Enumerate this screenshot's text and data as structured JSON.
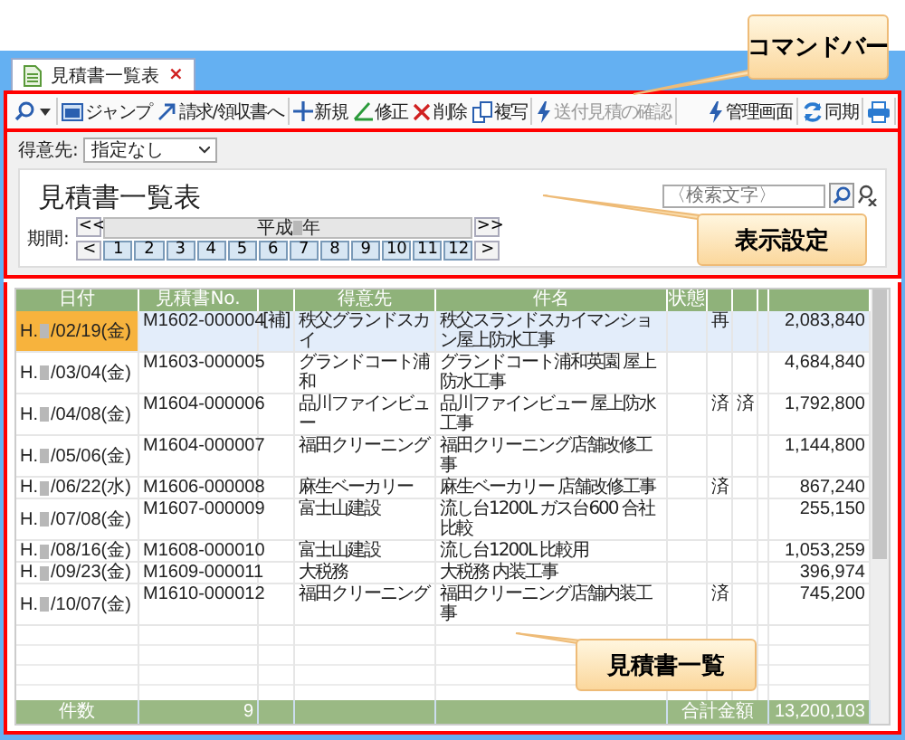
{
  "tab": {
    "title": "見積書一覧表",
    "close": "×"
  },
  "toolbar": {
    "groups": [
      [
        {
          "kind": "jump",
          "label": "ジャンプ",
          "disabled": false
        },
        {
          "kind": "arrow",
          "label": "請求/領収書へ",
          "disabled": false
        }
      ],
      [
        {
          "kind": "plus",
          "label": "新規",
          "disabled": false
        },
        {
          "kind": "pencil",
          "label": "修正",
          "disabled": false
        },
        {
          "kind": "cross",
          "label": "削除",
          "disabled": false
        },
        {
          "kind": "copy",
          "label": "複写",
          "disabled": false
        }
      ],
      [
        {
          "kind": "bolt",
          "label": "送付見積の確認",
          "disabled": true
        }
      ]
    ],
    "right_groups": [
      [
        {
          "kind": "bolt",
          "label": "管理画面",
          "disabled": false
        }
      ],
      [
        {
          "kind": "refresh",
          "label": "同期",
          "disabled": false
        }
      ],
      [
        {
          "kind": "printer"
        }
      ]
    ]
  },
  "customer_filter": {
    "label": "得意先:",
    "value": "指定なし"
  },
  "title": "見積書一覧表",
  "search": {
    "placeholder": "〈検索文字〉"
  },
  "period": {
    "label": "期間:",
    "prev_year": "<<",
    "next_year": ">>",
    "prev": "<",
    "next": ">",
    "year_prefix": "平成",
    "year_suffix": "年",
    "months": [
      "1",
      "2",
      "3",
      "4",
      "5",
      "6",
      "7",
      "8",
      "9",
      "10",
      "11",
      "12"
    ]
  },
  "table": {
    "columns": [
      "日付",
      "見積書No.",
      "得意先",
      "件名",
      "状態"
    ],
    "rows": [
      {
        "selected": true,
        "era": "H.",
        "date": "/02/19(金)",
        "number": "M1602-000004",
        "flag": "[補]",
        "customer": "秩父グランドスカイ",
        "subject": "秩父スランドスカイマンション屋上防水工事",
        "col_7": "再",
        "amount": "2,083,840"
      },
      {
        "selected": false,
        "era": "H.",
        "date": "/03/04(金)",
        "number": "M1603-000005",
        "customer": "グランドコート浦和",
        "subject": "グランドコート浦和英園 屋上防水工事",
        "amount": "4,684,840"
      },
      {
        "selected": false,
        "era": "H.",
        "date": "/04/08(金)",
        "number": "M1604-000006",
        "customer": "品川ファインビュー",
        "subject": "品川ファインビュー 屋上防水工事",
        "col_7": "済",
        "col_8": "済",
        "amount": "1,792,800"
      },
      {
        "selected": false,
        "era": "H.",
        "date": "/05/06(金)",
        "number": "M1604-000007",
        "customer": "福田クリーニング",
        "subject": "福田クリーニング店舗改修工事",
        "amount": "1,144,800"
      },
      {
        "selected": false,
        "era": "H.",
        "date": "/06/22(水)",
        "number": "M1606-000008",
        "customer": "麻生ベーカリー",
        "subject": "麻生ベーカリー 店舗改修工事",
        "col_7": "済",
        "amount": "867,240"
      },
      {
        "selected": false,
        "era": "H.",
        "date": "/07/08(金)",
        "number": "M1607-000009",
        "customer": "富士山建設",
        "subject": "流し台1200L ガス台600 合社比較",
        "amount": "255,150"
      },
      {
        "selected": false,
        "era": "H.",
        "date": "/08/16(金)",
        "number": "M1608-000010",
        "customer": "富士山建設",
        "subject": "流し台1200L 比較用",
        "amount": "1,053,259"
      },
      {
        "selected": false,
        "era": "H.",
        "date": "/09/23(金)",
        "number": "M1609-000011",
        "customer": "大税務",
        "subject": "大税務 内装工事",
        "amount": "396,974"
      },
      {
        "selected": false,
        "era": "H.",
        "date": "/10/07(金)",
        "number": "M1610-000012",
        "customer": "福田クリーニング",
        "subject": "福田クリーニング店舗内装工事",
        "col_7": "済",
        "amount": "745,200"
      }
    ],
    "footer": {
      "count_label": "件数",
      "count": "9",
      "total_label": "合計金額",
      "total": "13,200,103"
    }
  },
  "callouts": [
    {
      "text": "コマンドバー"
    },
    {
      "text": "表示設定"
    },
    {
      "text": "見積書一覧"
    }
  ]
}
